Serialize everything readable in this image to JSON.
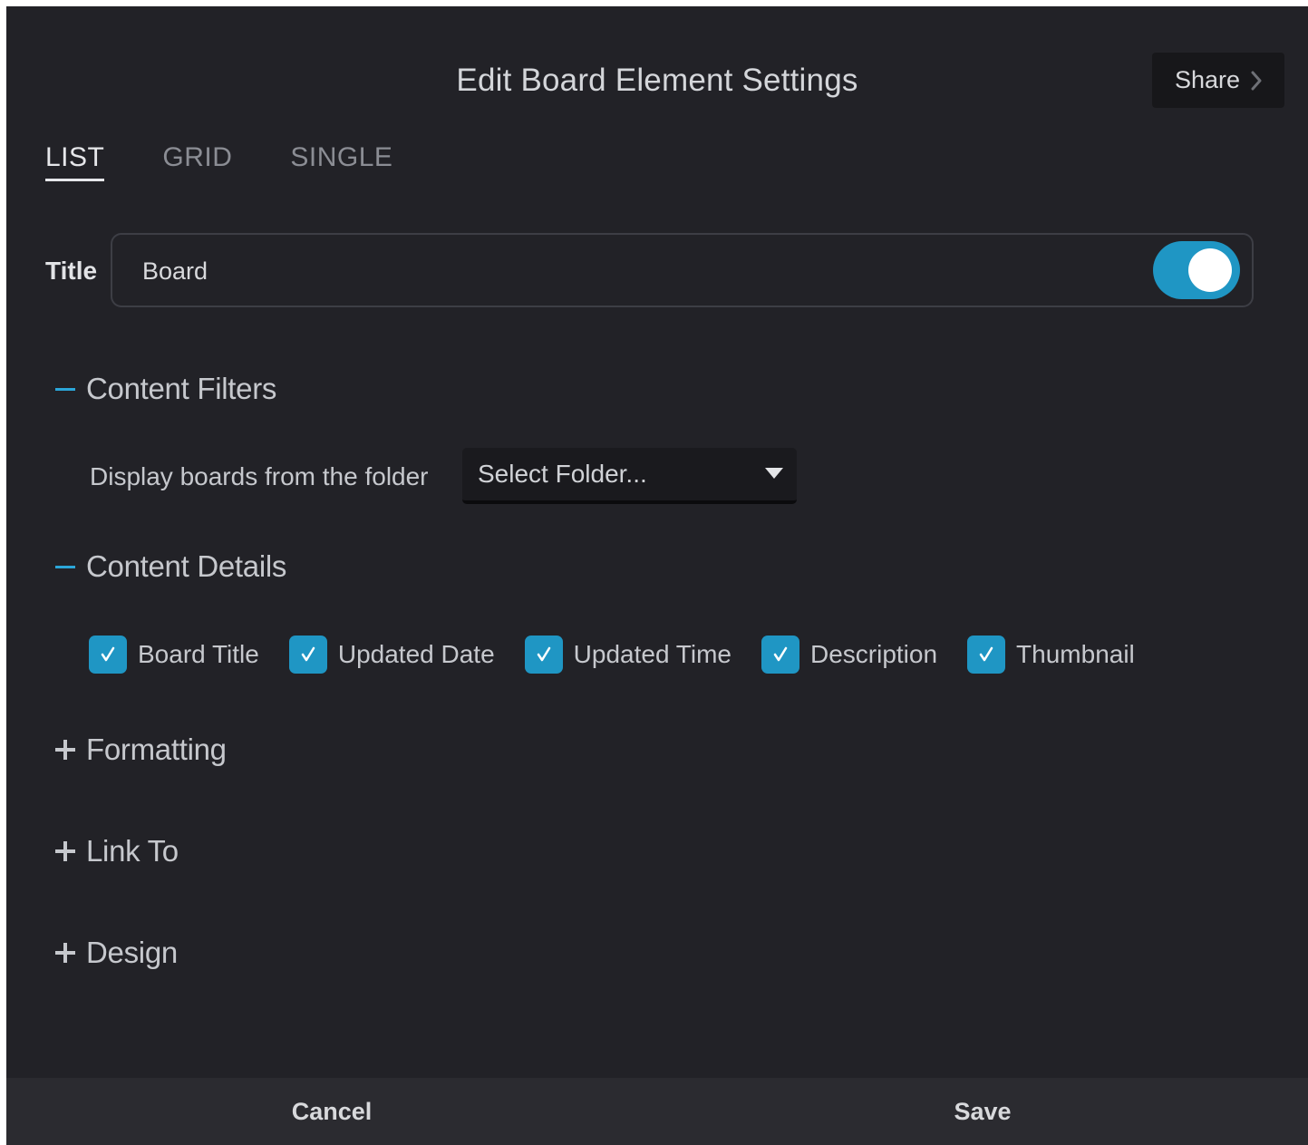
{
  "dialog": {
    "title": "Edit Board Element Settings",
    "share_label": "Share"
  },
  "tabs": [
    {
      "label": "LIST",
      "active": true
    },
    {
      "label": "GRID",
      "active": false
    },
    {
      "label": "SINGLE",
      "active": false
    }
  ],
  "title_field": {
    "label": "Title",
    "value": "Board",
    "toggle_on": true
  },
  "sections": {
    "content_filters": {
      "label": "Content Filters",
      "expanded": true,
      "folder_label": "Display boards from the folder",
      "folder_select_value": "Select Folder..."
    },
    "content_details": {
      "label": "Content Details",
      "expanded": true,
      "checkboxes": [
        {
          "label": "Board Title",
          "checked": true
        },
        {
          "label": "Updated Date",
          "checked": true
        },
        {
          "label": "Updated Time",
          "checked": true
        },
        {
          "label": "Description",
          "checked": true
        },
        {
          "label": "Thumbnail",
          "checked": true
        }
      ]
    },
    "formatting": {
      "label": "Formatting",
      "expanded": false
    },
    "link_to": {
      "label": "Link To",
      "expanded": false
    },
    "design": {
      "label": "Design",
      "expanded": false
    }
  },
  "footer": {
    "cancel_label": "Cancel",
    "save_label": "Save"
  },
  "colors": {
    "background": "#222227",
    "accent": "#1f96c4",
    "footer": "#2b2b30"
  },
  "icons": {
    "share": "chevron-right-icon",
    "folder_select": "caret-down-icon",
    "checkbox": "checkmark-icon",
    "expanded_section": "minus-icon",
    "collapsed_section": "plus-icon"
  }
}
